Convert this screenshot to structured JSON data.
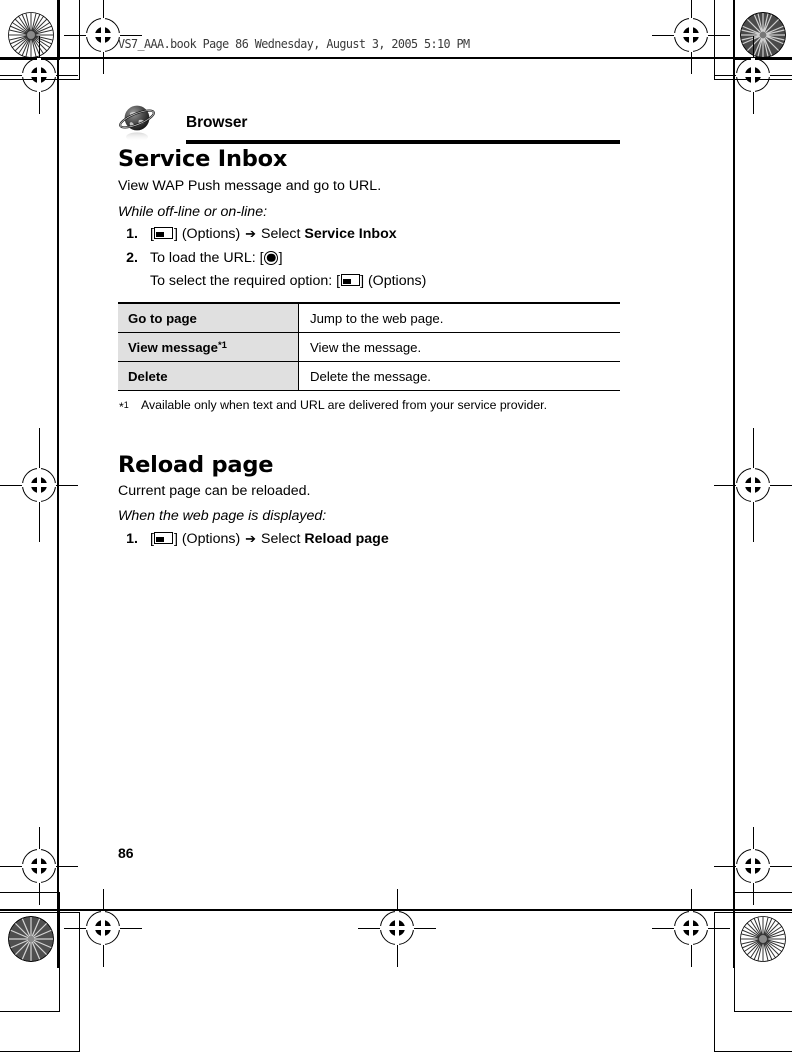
{
  "document": {
    "running_head": "VS7_AAA.book  Page 86  Wednesday, August 3, 2005  5:10 PM",
    "page_number": "86",
    "chapter": {
      "title": "Browser",
      "icon": "planet-globe-icon"
    }
  },
  "sections": [
    {
      "heading": "Service Inbox",
      "lede": "View WAP Push message and go to URL.",
      "condition": "While off-line or on-line:",
      "steps": [
        {
          "number": "1.",
          "pre": "[",
          "key": "softkey-icon",
          "post": "] (Options)",
          "arrow": "➔",
          "action_prefix": "Select ",
          "action_bold": "Service Inbox"
        },
        {
          "number": "2.",
          "line1_prefix": "To load the URL: [",
          "line1_key": "center-key-icon",
          "line1_suffix": "]",
          "line2_prefix": "To select the required option: [",
          "line2_key": "softkey-icon",
          "line2_suffix": "] (Options)"
        }
      ],
      "table": {
        "rows": [
          {
            "option": "Go to page",
            "option_footnote": "",
            "description": "Jump to the web page."
          },
          {
            "option": "View message",
            "option_footnote": "*1",
            "description": "View the message."
          },
          {
            "option": "Delete",
            "option_footnote": "",
            "description": "Delete the message."
          }
        ]
      },
      "footnote": {
        "marker": "*",
        "marker_sup": "1",
        "text": "Available only when text and URL are delivered from your service provider."
      }
    },
    {
      "heading": "Reload page",
      "lede": "Current page can be reloaded.",
      "condition": "When the web page is displayed:",
      "steps": [
        {
          "number": "1.",
          "pre": "[",
          "key": "softkey-icon",
          "post": "] (Options)",
          "arrow": "➔",
          "action_prefix": "Select ",
          "action_bold": "Reload page"
        }
      ]
    }
  ],
  "print_marks": {
    "registration_target": "registration-target-icon",
    "density_star": "density-starburst-icon"
  }
}
